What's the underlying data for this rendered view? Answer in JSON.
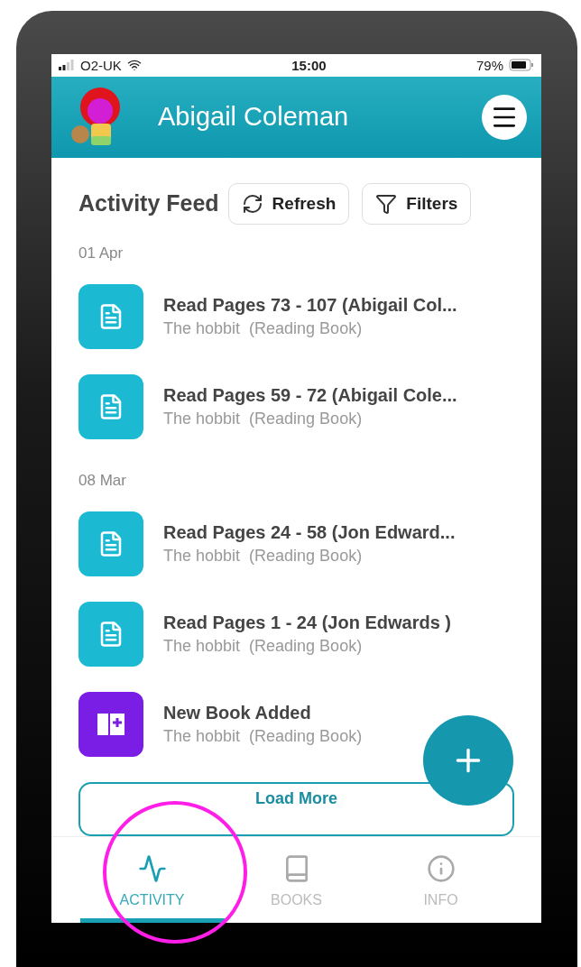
{
  "status_bar": {
    "carrier": "O2-UK",
    "time": "15:00",
    "battery": "79%"
  },
  "header": {
    "title": "Abigail Coleman"
  },
  "feed": {
    "title": "Activity Feed",
    "buttons": [
      {
        "kind": "refresh",
        "label": "Refresh"
      },
      {
        "kind": "filter",
        "label": "Filters"
      }
    ],
    "groups": [
      {
        "date": "01 Apr",
        "items": [
          {
            "kind": "pages",
            "title": "Read Pages 73 - 107 (Abigail Col...",
            "book": "The hobbit",
            "type": "(Reading Book)"
          },
          {
            "kind": "pages",
            "title": "Read Pages 59 - 72 (Abigail Cole...",
            "book": "The hobbit",
            "type": "(Reading Book)"
          }
        ]
      },
      {
        "date": "08 Mar",
        "items": [
          {
            "kind": "pages",
            "title": "Read Pages 24 - 58 (Jon Edward...",
            "book": "The hobbit",
            "type": "(Reading Book)"
          },
          {
            "kind": "pages",
            "title": "Read Pages 1 - 24 (Jon Edwards )",
            "book": "The hobbit",
            "type": "(Reading Book)"
          },
          {
            "kind": "new_book",
            "title": "New Book Added",
            "book": "The hobbit",
            "type": "(Reading Book)"
          }
        ]
      }
    ],
    "load_more": "Load More"
  },
  "tabs": [
    {
      "kind": "activity",
      "label": "ACTIVITY",
      "selected": true
    },
    {
      "kind": "books",
      "label": "BOOKS",
      "selected": false
    },
    {
      "kind": "info",
      "label": "INFO",
      "selected": false
    }
  ]
}
